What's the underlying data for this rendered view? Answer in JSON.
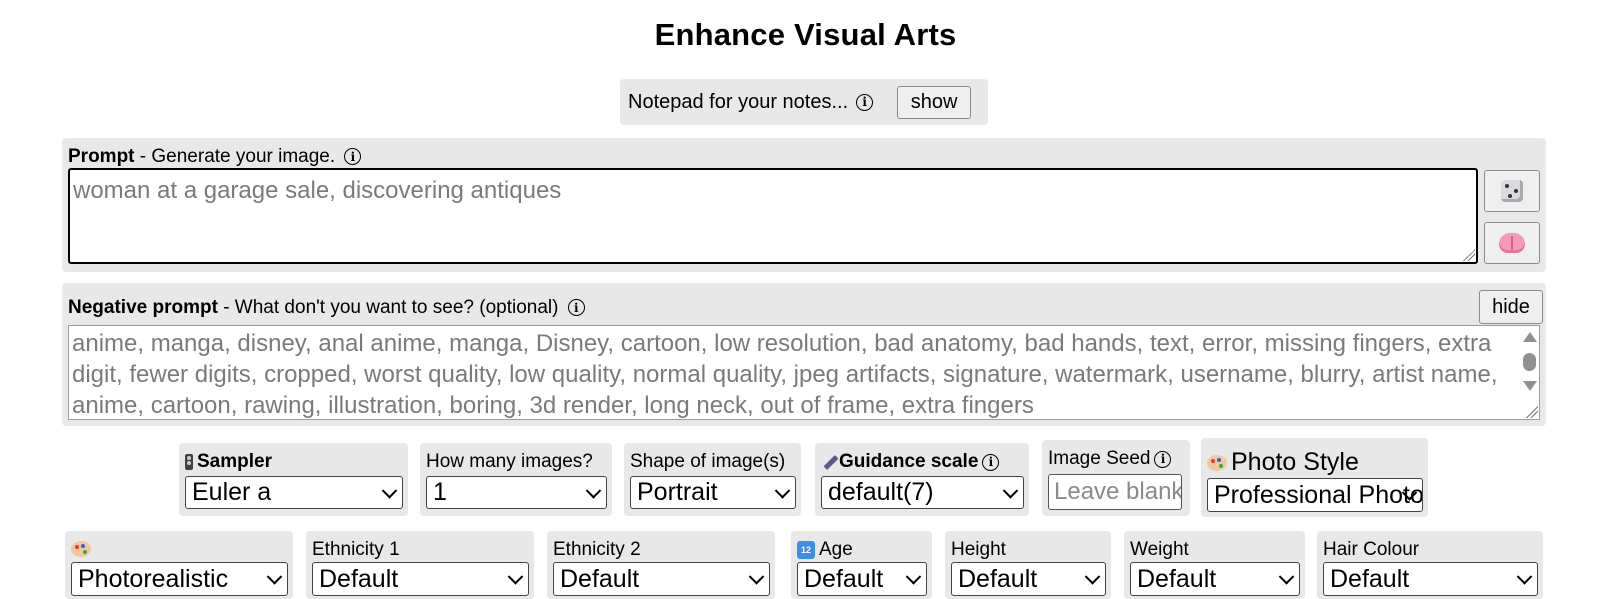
{
  "header": {
    "title": "Enhance Visual Arts"
  },
  "notepad": {
    "label": "Notepad for your notes...",
    "button": "show"
  },
  "prompt": {
    "label_bold": "Prompt",
    "label_rest": " - Generate your image.",
    "placeholder": "woman at a garage sale, discovering antiques"
  },
  "negative_prompt": {
    "label_bold": "Negative prompt",
    "label_rest": " - What don't you want to see? (optional)",
    "button": "hide",
    "value": "anime, manga, disney, anal anime, manga, Disney, cartoon, low resolution, bad anatomy, bad hands, text, error, missing fingers, extra digit, fewer digits, cropped, worst quality, low quality, normal quality, jpeg artifacts, signature, watermark, username, blurry, artist name, anime, cartoon, rawing, illustration, boring, 3d render, long neck, out of frame, extra fingers"
  },
  "row1": {
    "sampler": {
      "label": "Sampler",
      "value": "Euler a"
    },
    "num_images": {
      "label": "How many images?",
      "value": "1"
    },
    "shape": {
      "label": "Shape of image(s)",
      "value": "Portrait"
    },
    "guidance": {
      "label": "Guidance scale",
      "value": "default(7)"
    },
    "seed": {
      "label": "Image Seed",
      "placeholder": "Leave blank"
    },
    "photo_style": {
      "label": "Photo Style",
      "value": "Professional Photo"
    }
  },
  "row2": {
    "art_style": {
      "value": "Photorealistic"
    },
    "ethnicity1": {
      "label": "Ethnicity 1",
      "value": "Default"
    },
    "ethnicity2": {
      "label": "Ethnicity 2",
      "value": "Default"
    },
    "age": {
      "label": "Age",
      "value": "Default"
    },
    "height": {
      "label": "Height",
      "value": "Default"
    },
    "weight": {
      "label": "Weight",
      "value": "Default"
    },
    "hair_colour": {
      "label": "Hair Colour",
      "value": "Default"
    }
  },
  "icons": {
    "info": "info-icon",
    "dice": "dice-icon",
    "brain": "brain-icon",
    "sampler": "traffic-light-icon",
    "guidance": "pen-icon",
    "photo_style": "palette-icon",
    "art_style": "palette-icon",
    "age": "numbers-icon"
  },
  "colors": {
    "panel_bg": "#e8e8e8",
    "placeholder_text": "#7a7a7a",
    "button_bg": "#efefef"
  }
}
